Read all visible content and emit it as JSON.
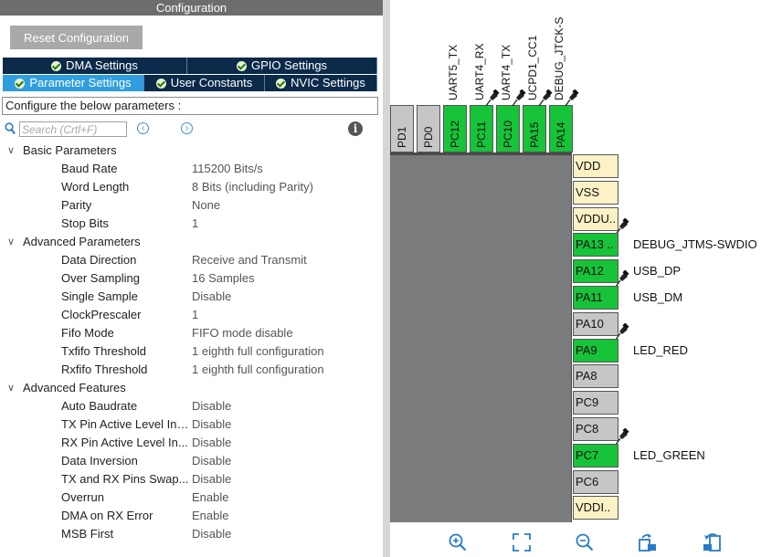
{
  "config": {
    "title": "Configuration",
    "reset_label": "Reset Configuration",
    "tabs_row1": [
      {
        "label": "DMA Settings",
        "active": false
      },
      {
        "label": "GPIO Settings",
        "active": false
      }
    ],
    "tabs_row2": [
      {
        "label": "Parameter Settings",
        "active": true
      },
      {
        "label": "User Constants",
        "active": false
      },
      {
        "label": "NVIC Settings",
        "active": false
      }
    ],
    "intro": "Configure the below parameters :",
    "search_placeholder": "Search (Crtl+F)",
    "groups": [
      {
        "name": "Basic Parameters",
        "params": [
          {
            "name": "Baud Rate",
            "value": "115200 Bits/s"
          },
          {
            "name": "Word Length",
            "value": "8 Bits (including Parity)"
          },
          {
            "name": "Parity",
            "value": "None"
          },
          {
            "name": "Stop Bits",
            "value": "1"
          }
        ]
      },
      {
        "name": "Advanced Parameters",
        "params": [
          {
            "name": "Data Direction",
            "value": "Receive and Transmit"
          },
          {
            "name": "Over Sampling",
            "value": "16 Samples"
          },
          {
            "name": "Single Sample",
            "value": "Disable"
          },
          {
            "name": "ClockPrescaler",
            "value": "1"
          },
          {
            "name": "Fifo Mode",
            "value": "FIFO mode disable"
          },
          {
            "name": "Txfifo Threshold",
            "value": "1 eighth full configuration"
          },
          {
            "name": "Rxfifo Threshold",
            "value": "1 eighth full configuration"
          }
        ]
      },
      {
        "name": "Advanced Features",
        "params": [
          {
            "name": "Auto Baudrate",
            "value": "Disable"
          },
          {
            "name": "TX Pin Active Level Inv...",
            "value": "Disable"
          },
          {
            "name": "RX Pin Active Level In...",
            "value": "Disable"
          },
          {
            "name": "Data Inversion",
            "value": "Disable"
          },
          {
            "name": "TX and RX Pins Swap...",
            "value": "Disable"
          },
          {
            "name": "Overrun",
            "value": "Enable"
          },
          {
            "name": "DMA on RX Error",
            "value": "Enable"
          },
          {
            "name": "MSB First",
            "value": "Disable"
          }
        ]
      }
    ]
  },
  "chip": {
    "top_pins": [
      {
        "label": "PD1",
        "signal": "",
        "state": "unused",
        "pinned": false
      },
      {
        "label": "PD0",
        "signal": "",
        "state": "unused",
        "pinned": false
      },
      {
        "label": "PC12",
        "signal": "UART5_TX",
        "state": "assigned",
        "pinned": false
      },
      {
        "label": "PC11",
        "signal": "UART4_RX",
        "state": "assigned",
        "pinned": true
      },
      {
        "label": "PC10",
        "signal": "UART4_TX",
        "state": "assigned",
        "pinned": true
      },
      {
        "label": "PA15",
        "signal": "UCPD1_CC1",
        "state": "assigned",
        "pinned": true
      },
      {
        "label": "PA14",
        "signal": "DEBUG_JTCK-S",
        "state": "assigned",
        "pinned": true
      }
    ],
    "right_pins": [
      {
        "label": "VDD",
        "signal": "",
        "state": "power",
        "pinned": false
      },
      {
        "label": "VSS",
        "signal": "",
        "state": "power",
        "pinned": false
      },
      {
        "label": "VDDU..",
        "signal": "",
        "state": "power",
        "pinned": true
      },
      {
        "label": "PA13 ..",
        "signal": "DEBUG_JTMS-SWDIO",
        "state": "assigned",
        "pinned": false
      },
      {
        "label": "PA12",
        "signal": "USB_DP",
        "state": "assigned",
        "pinned": true
      },
      {
        "label": "PA11",
        "signal": "USB_DM",
        "state": "assigned",
        "pinned": false
      },
      {
        "label": "PA10",
        "signal": "",
        "state": "unused",
        "pinned": true
      },
      {
        "label": "PA9",
        "signal": "LED_RED",
        "state": "assigned",
        "pinned": false
      },
      {
        "label": "PA8",
        "signal": "",
        "state": "unused",
        "pinned": false
      },
      {
        "label": "PC9",
        "signal": "",
        "state": "unused",
        "pinned": false
      },
      {
        "label": "PC8",
        "signal": "",
        "state": "unused",
        "pinned": true
      },
      {
        "label": "PC7",
        "signal": "LED_GREEN",
        "state": "assigned",
        "pinned": false
      },
      {
        "label": "PC6",
        "signal": "",
        "state": "unused",
        "pinned": false
      },
      {
        "label": "VDDI..",
        "signal": "",
        "state": "power",
        "pinned": false
      }
    ]
  },
  "toolbar": [
    "zoom-in-icon",
    "fit-screen-icon",
    "zoom-out-icon",
    "rotate-right-icon",
    "rotate-left-icon"
  ],
  "colors": {
    "tab_dark": "#0b2a4a",
    "tab_active": "#2f9ede",
    "pin_assigned": "#17c339",
    "pin_unused": "#c6c6c6",
    "pin_power": "#fdf1c6",
    "chip_body": "#7a7b7d"
  }
}
